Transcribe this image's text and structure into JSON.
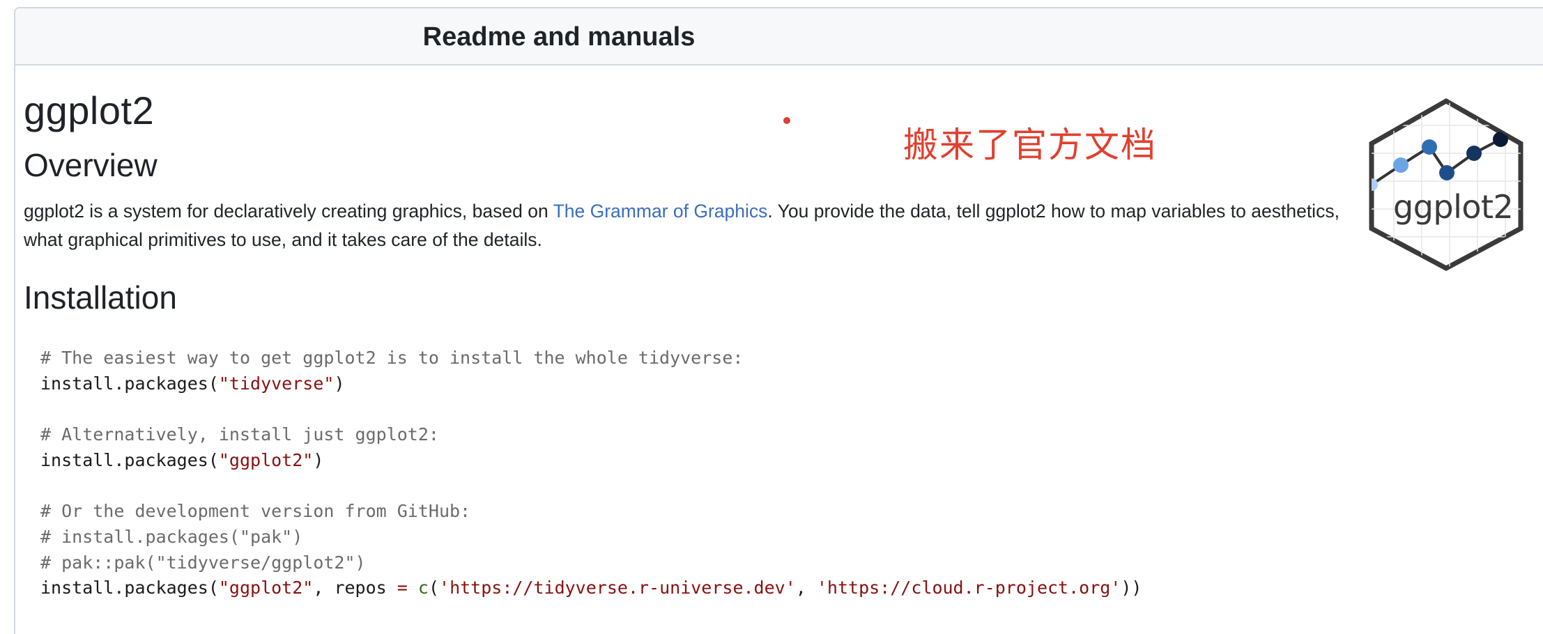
{
  "panel": {
    "title": "Readme and manuals"
  },
  "readme": {
    "title": "ggplot2",
    "overview_heading": "Overview",
    "overview_text_before_link": "ggplot2 is a system for declaratively creating graphics, based on ",
    "overview_link": "The Grammar of Graphics",
    "overview_text_after_link": ". You provide the data, tell ggplot2 how to map variables to aesthetics, what graphical primitives to use, and it takes care of the details.",
    "installation_heading": "Installation",
    "code": {
      "comment1": "# The easiest way to get ggplot2 is to install the whole tidyverse:",
      "l2_fn": "install.packages(",
      "l2_str": "\"tidyverse\"",
      "l2_end": ")",
      "comment2": "# Alternatively, install just ggplot2:",
      "l5_fn": "install.packages(",
      "l5_str": "\"ggplot2\"",
      "l5_end": ")",
      "comment3": "# Or the development version from GitHub:",
      "comment4": "# install.packages(\"pak\")",
      "comment5": "# pak::pak(\"tidyverse/ggplot2\")",
      "l11_fn": "install.packages(",
      "l11_str1": "\"ggplot2\"",
      "l11_mid1": ", repos ",
      "l11_op": "=",
      "l11_sp": " ",
      "l11_c": "c",
      "l11_paren": "(",
      "l11_str2": "'https://tidyverse.r-universe.dev'",
      "l11_comma": ", ",
      "l11_str3": "'https://cloud.r-project.org'",
      "l11_end": "))"
    }
  },
  "annotation": {
    "text": "搬来了官方文档",
    "color": "#e0402f"
  },
  "logo": {
    "label": "ggplot2",
    "icon": "ggplot2-hex-logo"
  },
  "colors": {
    "link": "#3b6dbf",
    "string": "#8a0f0f",
    "comment": "#6b6b6b"
  }
}
